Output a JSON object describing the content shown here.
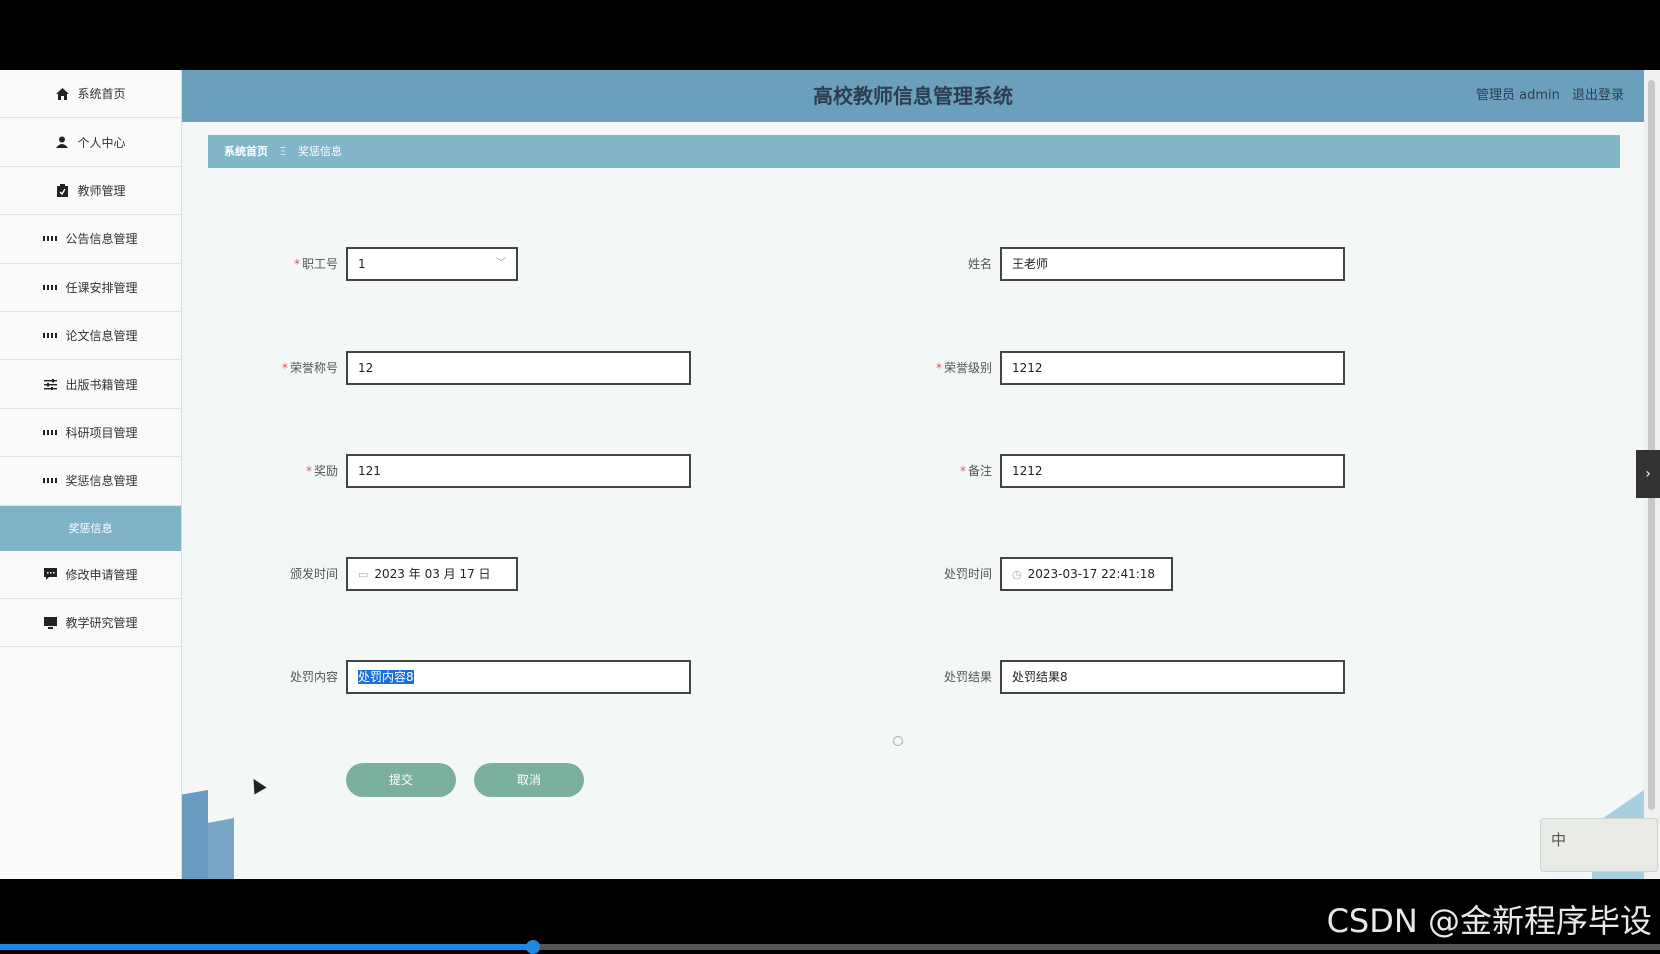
{
  "header": {
    "title": "高校教师信息管理系统",
    "user_label": "管理员 admin",
    "logout_label": "退出登录"
  },
  "sidebar": {
    "items": [
      {
        "label": "系统首页",
        "icon": "home-icon"
      },
      {
        "label": "个人中心",
        "icon": "user-icon"
      },
      {
        "label": "教师管理",
        "icon": "clipboard-icon"
      },
      {
        "label": "公告信息管理",
        "icon": "grid-icon"
      },
      {
        "label": "任课安排管理",
        "icon": "grid-icon"
      },
      {
        "label": "论文信息管理",
        "icon": "grid-icon"
      },
      {
        "label": "出版书籍管理",
        "icon": "sliders-icon"
      },
      {
        "label": "科研项目管理",
        "icon": "grid-icon"
      },
      {
        "label": "奖惩信息管理",
        "icon": "grid-icon"
      },
      {
        "label": "奖惩信息",
        "icon": ""
      },
      {
        "label": "修改申请管理",
        "icon": "chat-icon"
      },
      {
        "label": "教学研究管理",
        "icon": "monitor-icon"
      }
    ]
  },
  "breadcrumb": {
    "home": "系统首页",
    "separator": "Ξ",
    "current": "奖惩信息"
  },
  "form": {
    "staff_id": {
      "label": "职工号",
      "value": "1"
    },
    "name": {
      "label": "姓名",
      "value": "王老师"
    },
    "honor_title": {
      "label": "荣誉称号",
      "value": "12"
    },
    "honor_level": {
      "label": "荣誉级别",
      "value": "1212"
    },
    "reward": {
      "label": "奖励",
      "value": "121"
    },
    "remark": {
      "label": "备注",
      "value": "1212"
    },
    "issue_date": {
      "label": "颁发时间",
      "value": "2023 年 03 月 17 日"
    },
    "punish_time": {
      "label": "处罚时间",
      "value": "2023-03-17 22:41:18"
    },
    "punish_content": {
      "label": "处罚内容",
      "value": "处罚内容8"
    },
    "punish_result": {
      "label": "处罚结果",
      "value": "处罚结果8"
    }
  },
  "buttons": {
    "submit": "提交",
    "cancel": "取消"
  },
  "ime": {
    "lang": "中"
  },
  "watermark": "CSDN @金新程序毕设",
  "colors": {
    "header_bg": "#6aa0bc",
    "breadcrumb_bg": "#82b6ca",
    "active_sidebar_bg": "#7fb3c8",
    "button_bg": "#7bb0a0"
  },
  "video_progress": 0.32
}
